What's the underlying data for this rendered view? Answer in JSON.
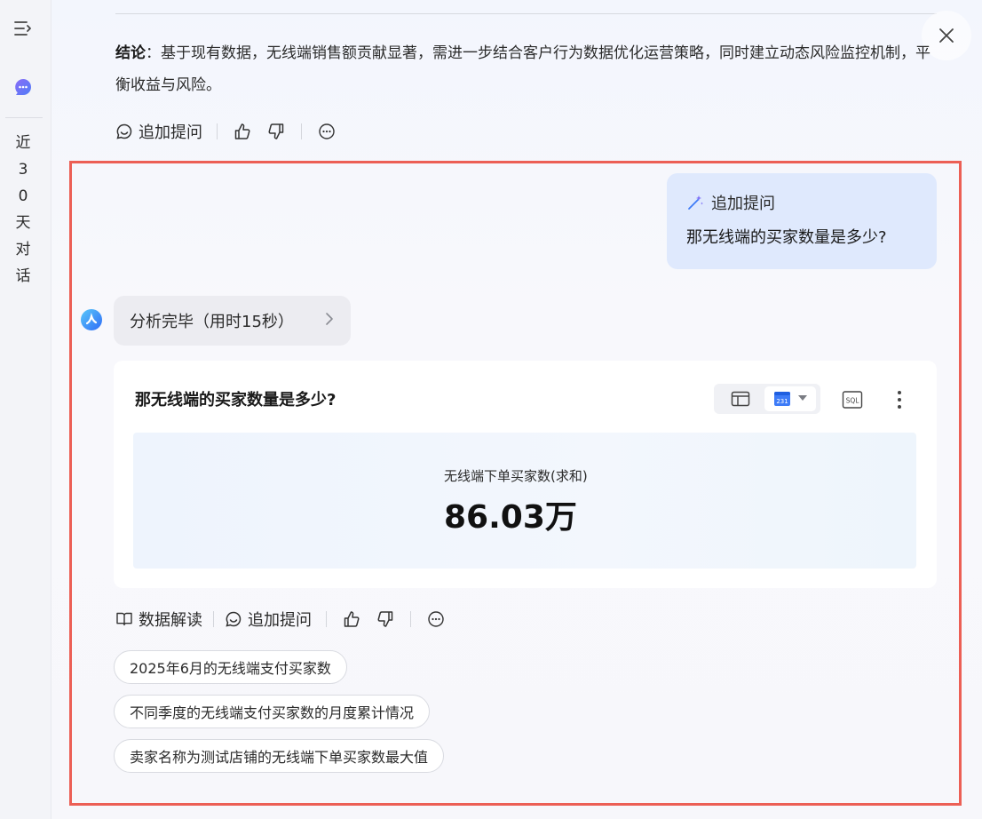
{
  "sidebar": {
    "vertical_text": [
      "近",
      "3",
      "0",
      "天",
      "对",
      "话"
    ]
  },
  "conclusion": {
    "label": "结论",
    "text": "：基于现有数据，无线端销售额贡献显著，需进一步结合客户行为数据优化运营策略，同时建立动态风险监控机制，平衡收益与风险。"
  },
  "actions_top": {
    "follow_up": "追加提问"
  },
  "user_message": {
    "tag": "追加提问",
    "question": "那无线端的买家数量是多少?"
  },
  "analysis_status": {
    "text": "分析完毕（用时15秒）"
  },
  "result_card": {
    "title": "那无线端的买家数量是多少?",
    "calendar_number": "231",
    "sql_label": "SQL",
    "metric_label": "无线端下单买家数(求和)",
    "metric_value": "86.03万"
  },
  "actions_bottom": {
    "interpret": "数据解读",
    "follow_up": "追加提问"
  },
  "suggestions": [
    "2025年6月的无线端支付买家数",
    "不同季度的无线端支付买家数的月度累计情况",
    "卖家名称为测试店铺的无线端下单买家数最大值"
  ],
  "colors": {
    "highlight_border": "#ec5f55",
    "user_bubble": "#dfe9fd",
    "accent_blue": "#3d7bf7"
  }
}
